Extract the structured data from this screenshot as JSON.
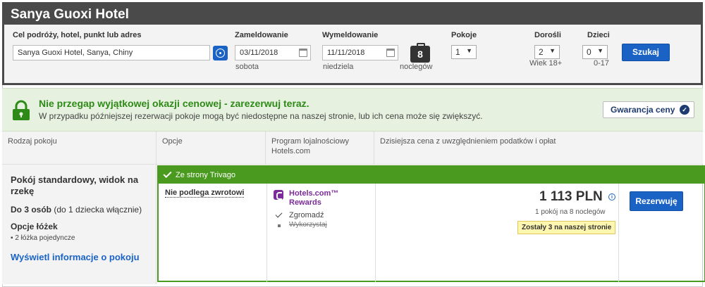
{
  "header": {
    "hotel_title": "Sanya Guoxi Hotel"
  },
  "search": {
    "destination_label": "Cel podróży, hotel, punkt lub adres",
    "destination_value": "Sanya Guoxi Hotel, Sanya, Chiny",
    "checkin_label": "Zameldowanie",
    "checkin_value": "03/11/2018",
    "checkin_day": "sobota",
    "checkout_label": "Wymeldowanie",
    "checkout_value": "11/11/2018",
    "checkout_day": "niedziela",
    "nights_count": "8",
    "nights_label": "noclegów",
    "rooms_label": "Pokoje",
    "rooms_value": "1",
    "adults_label": "Dorośli",
    "adults_value": "2",
    "adults_note": "Wiek 18+",
    "children_label": "Dzieci",
    "children_value": "0",
    "children_note": "0-17",
    "search_button": "Szukaj"
  },
  "promo": {
    "title": "Nie przegap wyjątkowej okazji cenowej - zarezerwuj teraz.",
    "text": "W przypadku późniejszej rezerwacji pokoje mogą być niedostępne na naszej stronie, lub ich cena może się zwiększyć.",
    "guarantee_button": "Gwarancja ceny"
  },
  "table": {
    "col_room_type": "Rodzaj pokoju",
    "col_options": "Opcje",
    "col_loyalty_line1": "Program lojalnościowy",
    "col_loyalty_line2": "Hotels.com",
    "col_price": "Dzisiejsza cena z uwzględnieniem podatków i opłat"
  },
  "room": {
    "name": "Pokój standardowy, widok na rzekę",
    "occupancy_bold": "Do 3 osób",
    "occupancy_rest": " (do 1 dziecka włącznie)",
    "beds_label": "Opcje łóżek",
    "beds_item": "2 łóżka pojedyncze",
    "info_link": "Wyświetl informacje o pokoju"
  },
  "offer": {
    "source": "Ze strony Trivago",
    "policy": "Nie podlega zwrotowi",
    "rewards_name": "Hotels.com™ Rewards",
    "rewards_collect": "Zgromadź",
    "rewards_redeem": "Wykorzystaj",
    "price": "1 113 PLN",
    "price_note": "1 pokój na 8 noclegów",
    "availability": "Zostały 3 na naszej stronie",
    "book_button": "Rezerwuję"
  },
  "colors": {
    "accent_blue": "#1a63c5",
    "offer_green": "#4a9a1f",
    "rewards_purple": "#7b2b9a"
  }
}
